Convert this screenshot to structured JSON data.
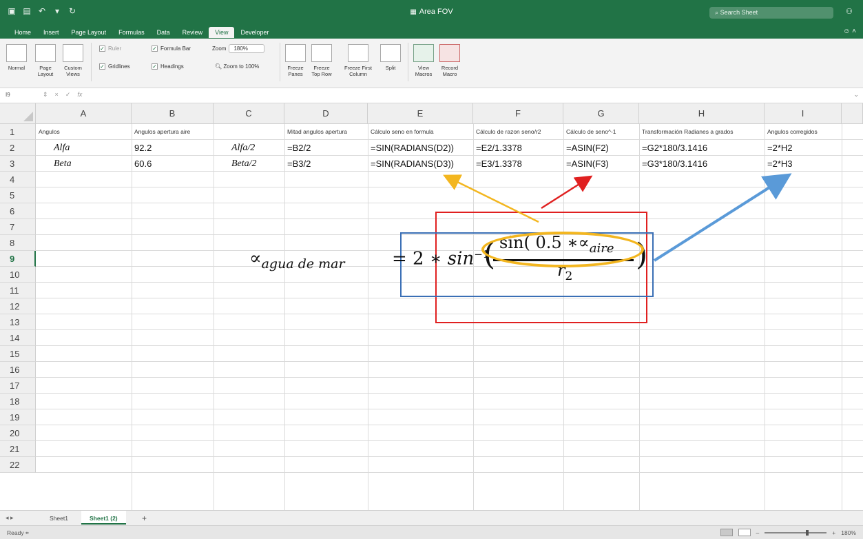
{
  "window": {
    "title": "Area FOV",
    "search_placeholder": "Search Sheet",
    "title_icons": [
      "sidebar-icon",
      "save-icon",
      "undo-icon",
      "dropdown-icon",
      "redo-icon"
    ]
  },
  "ribbon_tabs": [
    {
      "label": "Home"
    },
    {
      "label": "Insert"
    },
    {
      "label": "Page Layout"
    },
    {
      "label": "Formulas"
    },
    {
      "label": "Data"
    },
    {
      "label": "Review"
    },
    {
      "label": "View",
      "active": true
    },
    {
      "label": "Developer"
    }
  ],
  "ribbon": {
    "normal": "Normal",
    "page_layout": "Page Layout",
    "custom_views": "Custom Views",
    "ruler": "Ruler",
    "formula_bar": "Formula Bar",
    "gridlines": "Gridlines",
    "headings": "Headings",
    "zoom_label": "Zoom",
    "zoom_value": "180%",
    "zoom_to_100": "Zoom to 100%",
    "freeze_panes": "Freeze Panes",
    "freeze_top_row": "Freeze Top Row",
    "freeze_first_column": "Freeze First Column",
    "split": "Split",
    "view_macros": "View Macros",
    "record_macro": "Record Macro"
  },
  "formula_bar": {
    "name_box": "I9",
    "fx": "fx"
  },
  "columns": [
    "A",
    "B",
    "C",
    "D",
    "E",
    "F",
    "G",
    "H",
    "I"
  ],
  "rows": [
    "1",
    "2",
    "3",
    "4",
    "5",
    "6",
    "7",
    "8",
    "9",
    "10",
    "11",
    "12",
    "13",
    "14",
    "15",
    "16",
    "17",
    "18",
    "19",
    "20",
    "21",
    "22"
  ],
  "selected_row": "9",
  "cells": {
    "A1": "Angulos",
    "B1": "Angulos apertura aire",
    "D1": "Mitad angulos apertura",
    "E1": "Cálculo seno en formula",
    "F1": "Cálculo de razon seno/r2",
    "G1": "Cálculo de seno^-1",
    "H1": "Transformación Radianes a grados",
    "I1": "Angulos corregidos",
    "A2": "Alfa",
    "B2": "92.2",
    "C2": "Alfa/2",
    "D2": "=B2/2",
    "E2": "=SIN(RADIANS(D2))",
    "F2": "=E2/1.3378",
    "G2": "=ASIN(F2)",
    "H2": "=G2*180/3.1416",
    "I2": "=2*H2",
    "A3": "Beta",
    "B3": "60.6",
    "C3": "Beta/2",
    "D3": "=B3/2",
    "E3": "=SIN(RADIANS(D3))",
    "F3": "=E3/1.3378",
    "G3": "=ASIN(F3)",
    "H3": "=G3*180/3.1416",
    "I3": "=2*H3"
  },
  "equation": {
    "lhs": "∝",
    "lhs_sub": "agua de mar",
    "rhs_prefix": "= 2 ∗ ",
    "rhs_fn": "sin",
    "rhs_exp": "−1",
    "numerator": "sin( 0.5 ∗∝",
    "numerator_sub": "aire",
    "denominator": "r",
    "denominator_sub": "2"
  },
  "annotation_colors": {
    "red_box": "#e02020",
    "blue_box": "#3a6fb5",
    "yellow_ellipse": "#f3b61f"
  },
  "sheet_tabs": [
    {
      "label": "Sheet1"
    },
    {
      "label": "Sheet1 (2)",
      "active": true
    }
  ],
  "status": {
    "ready": "Ready",
    "zoom": "180%"
  }
}
